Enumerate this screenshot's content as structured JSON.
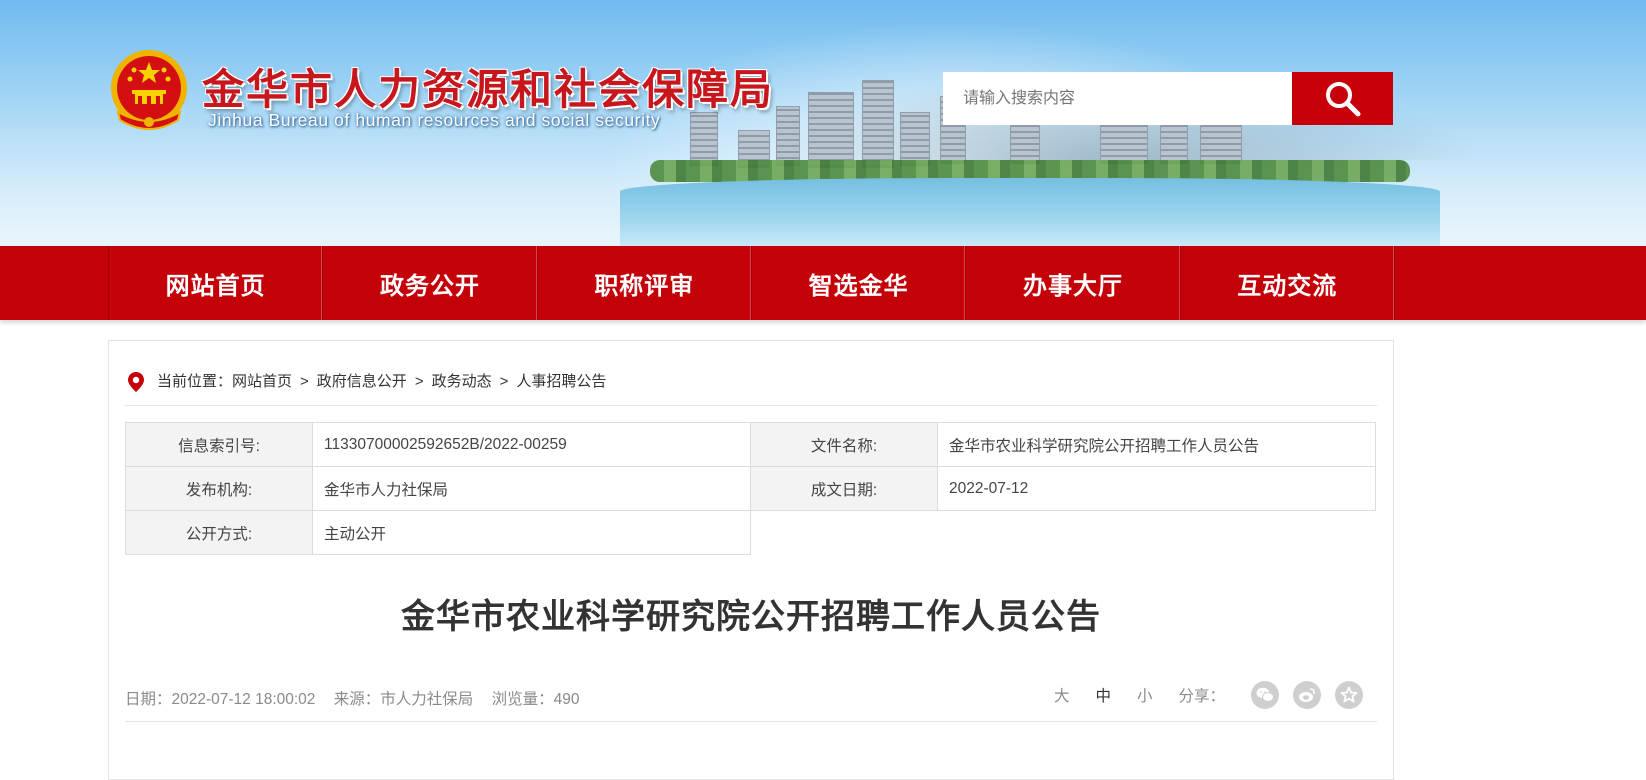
{
  "header": {
    "title": "金华市人力资源和社会保障局",
    "subtitle": "Jinhua Bureau of human resources and social security",
    "search_placeholder": "请输入搜索内容"
  },
  "nav": [
    {
      "label": "网站首页"
    },
    {
      "label": "政务公开"
    },
    {
      "label": "职称评审"
    },
    {
      "label": "智选金华"
    },
    {
      "label": "办事大厅"
    },
    {
      "label": "互动交流"
    }
  ],
  "breadcrumb": {
    "prefix": "当前位置：",
    "items": [
      "网站首页",
      "政府信息公开",
      "政务动态",
      "人事招聘公告"
    ],
    "separator": ">"
  },
  "meta": {
    "index_label": "信息索引号:",
    "index_value": "11330700002592652B/2022-00259",
    "doc_name_label": "文件名称:",
    "doc_name_value": "金华市农业科学研究院公开招聘工作人员公告",
    "publisher_label": "发布机构:",
    "publisher_value": "金华市人力社保局",
    "date_label": "成文日期:",
    "date_value": "2022-07-12",
    "open_label": "公开方式:",
    "open_value": "主动公开"
  },
  "article": {
    "title": "金华市农业科学研究院公开招聘工作人员公告",
    "date": "日期：2022-07-12 18:00:02",
    "source": "来源：市人力社保局",
    "views": "浏览量：490"
  },
  "tools": {
    "font_large": "大",
    "font_medium": "中",
    "font_small": "小",
    "share_label": "分享：",
    "share_icons": [
      "wechat-icon",
      "weibo-icon",
      "favorite-icon"
    ]
  },
  "colors": {
    "nav_red": "#c40008",
    "title_red": "#c8161d",
    "search_button": "#c8000a"
  }
}
